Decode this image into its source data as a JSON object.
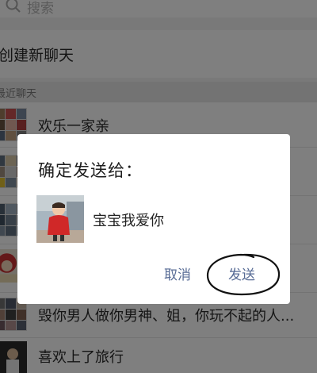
{
  "search": {
    "placeholder": "搜索",
    "icon": "search-icon"
  },
  "new_chat": {
    "label": "创建新聊天"
  },
  "recent_section": {
    "label": "最近聊天"
  },
  "chats": [
    {
      "name": "欢乐一家亲",
      "avatar": "group-avatar-icon"
    },
    {
      "name": "",
      "avatar": "group-avatar-icon"
    },
    {
      "name": "",
      "avatar": "group-avatar-icon"
    },
    {
      "name": "",
      "avatar": "group-avatar-icon"
    },
    {
      "name": "毁你男人做你男神、姐，你玩不起的人...",
      "avatar": "group-avatar-icon"
    },
    {
      "name": "喜欢上了旅行",
      "avatar": "person-avatar-icon"
    }
  ],
  "dialog": {
    "title": "确定发送给：",
    "recipient": "宝宝我爱你",
    "cancel_label": "取消",
    "send_label": "发送"
  },
  "colors": {
    "link": "#576b95",
    "overlay": "rgba(0,0,0,0.5)",
    "annotation": "#111111"
  }
}
